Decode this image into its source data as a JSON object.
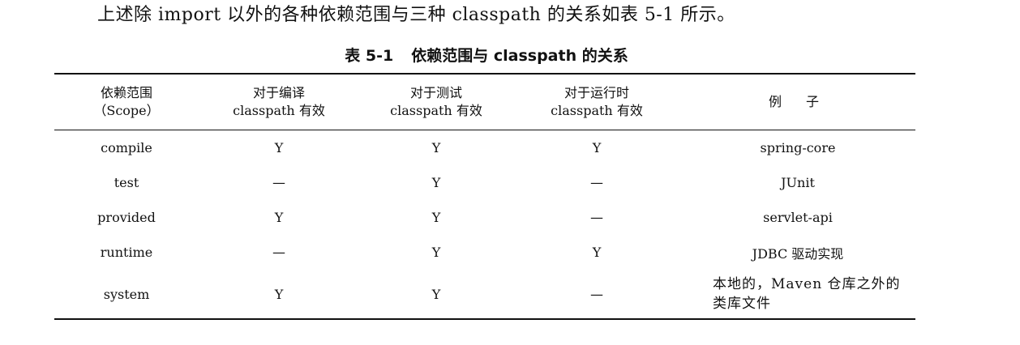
{
  "intro_text": "上述除 import 以外的各种依赖范围与三种 classpath 的关系如表 5-1 所示。",
  "caption": {
    "number": "表 5-1",
    "title": "依赖范围与 classpath 的关系"
  },
  "table": {
    "headers": [
      {
        "line1": "依赖范围",
        "line2": "（Scope）"
      },
      {
        "line1": "对于编译",
        "line2": "classpath 有效"
      },
      {
        "line1": "对于测试",
        "line2": "classpath 有效"
      },
      {
        "line1": "对于运行时",
        "line2": "classpath 有效"
      },
      {
        "line1": "例子",
        "line2": ""
      }
    ],
    "rows": [
      {
        "scope": "compile",
        "compile": "Y",
        "test": "Y",
        "runtime": "Y",
        "example": "spring-core"
      },
      {
        "scope": "test",
        "compile": "—",
        "test": "Y",
        "runtime": "—",
        "example": "JUnit"
      },
      {
        "scope": "provided",
        "compile": "Y",
        "test": "Y",
        "runtime": "—",
        "example": "servlet-api"
      },
      {
        "scope": "runtime",
        "compile": "—",
        "test": "Y",
        "runtime": "Y",
        "example": "JDBC 驱动实现"
      },
      {
        "scope": "system",
        "compile": "Y",
        "test": "Y",
        "runtime": "—",
        "example": "本地的，Maven 仓库之外的类库文件"
      }
    ]
  }
}
